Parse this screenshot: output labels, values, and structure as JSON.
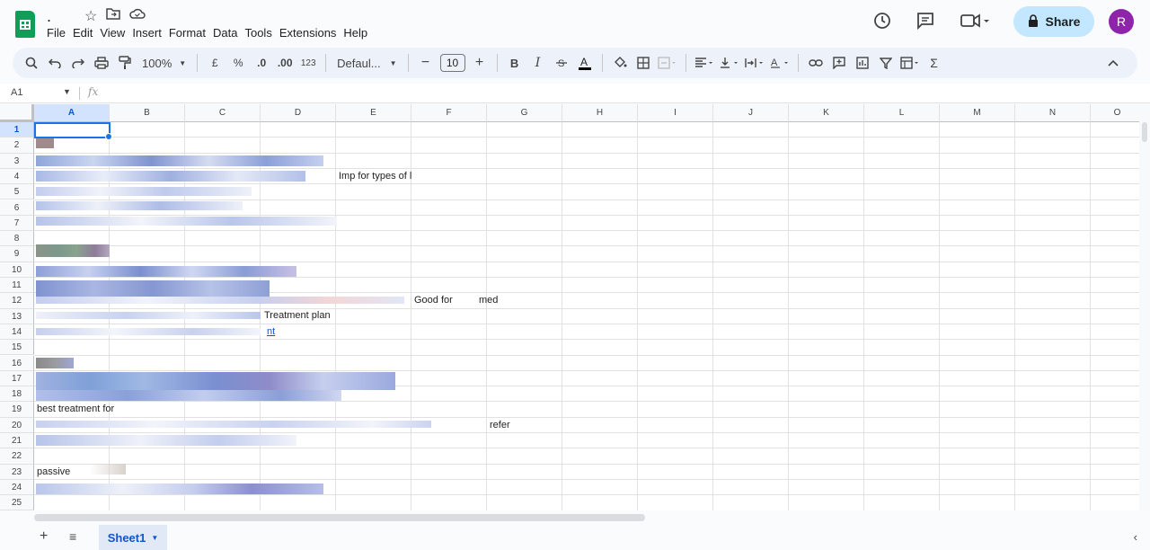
{
  "app": {
    "doc_title": ".",
    "menu": [
      "File",
      "Edit",
      "View",
      "Insert",
      "Format",
      "Data",
      "Tools",
      "Extensions",
      "Help"
    ],
    "share_label": "Share",
    "avatar_initial": "R"
  },
  "toolbar": {
    "zoom": "100%",
    "currency": "£",
    "percent": "%",
    "dec_decrease": ".0",
    "dec_increase": ".00",
    "number_format": "123",
    "font": "Defaul...",
    "font_size": "10",
    "bold": "B",
    "italic": "I"
  },
  "formula_bar": {
    "name_box": "A1",
    "fx": "fx"
  },
  "columns": [
    "A",
    "B",
    "C",
    "D",
    "E",
    "F",
    "G",
    "H",
    "I",
    "J",
    "K",
    "L",
    "M",
    "N",
    "O"
  ],
  "rows": [
    "1",
    "2",
    "3",
    "4",
    "5",
    "6",
    "7",
    "8",
    "9",
    "10",
    "11",
    "12",
    "13",
    "14",
    "15",
    "16",
    "17",
    "18",
    "19",
    "20",
    "21",
    "22",
    "23",
    "24",
    "25"
  ],
  "cells": {
    "e4": "Imp for types of l",
    "f12": "Good for",
    "f12_tail": "med",
    "d13": "Treatment plan",
    "c14": "nt",
    "a19": "best treatment for",
    "g20": "refer",
    "a23": "passive"
  },
  "sheet_tabs": [
    {
      "label": "Sheet1"
    }
  ]
}
